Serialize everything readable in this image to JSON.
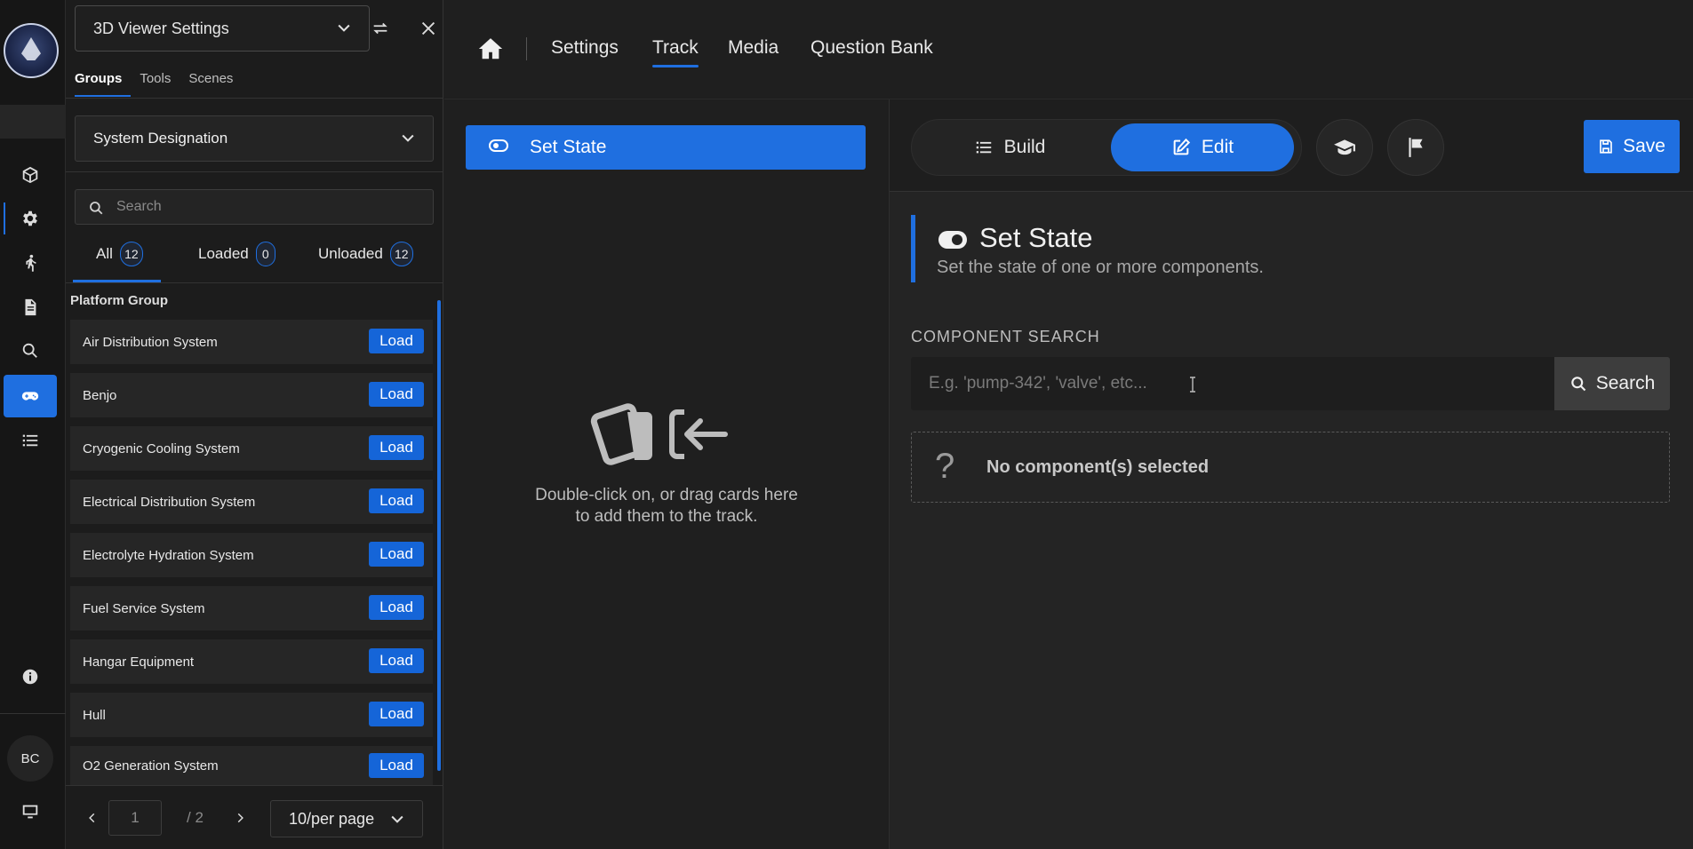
{
  "rail": {
    "avatar_initials": "BC",
    "items": [
      "cube-icon",
      "gear-icon",
      "walking-icon",
      "document-icon",
      "search-icon",
      "gamepad-icon",
      "list-icon",
      "info-icon",
      "monitor-icon"
    ],
    "active_item": "gamepad-icon"
  },
  "panel": {
    "dropdown_label": "3D Viewer Settings",
    "tabs": [
      "Groups",
      "Tools",
      "Scenes"
    ],
    "active_tab": "Groups",
    "designation_label": "System Designation",
    "search_placeholder": "Search",
    "filters": [
      {
        "label": "All",
        "count": "12"
      },
      {
        "label": "Loaded",
        "count": "0"
      },
      {
        "label": "Unloaded",
        "count": "12"
      }
    ],
    "active_filter": "All",
    "group_label": "Platform Group",
    "load_label": "Load",
    "items": [
      "Air Distribution System",
      "Benjo",
      "Cryogenic Cooling System",
      "Electrical Distribution System",
      "Electrolyte Hydration System",
      "Fuel Service System",
      "Hangar Equipment",
      "Hull",
      "O2 Generation System"
    ],
    "pager": {
      "page": "1",
      "total": "/ 2",
      "per_page": "10/per page"
    }
  },
  "nav": {
    "links": [
      "Settings",
      "Track",
      "Media",
      "Question Bank"
    ],
    "active": "Track"
  },
  "track": {
    "card_label": "Set State",
    "empty_text": "Double-click on, or drag cards here to add them to the track."
  },
  "editor": {
    "build_label": "Build",
    "edit_label": "Edit",
    "mode": "Edit",
    "save_label": "Save",
    "step_title": "Set State",
    "step_description": "Set the state of one or more components.",
    "component_search_label": "COMPONENT SEARCH",
    "component_search_placeholder": "E.g. 'pump-342', 'valve', etc...",
    "search_button_label": "Search",
    "no_component_text": "No component(s) selected",
    "no_component_glyph": "?"
  },
  "colors": {
    "accent": "#1f6fe0",
    "background": "#1f1f1f"
  }
}
